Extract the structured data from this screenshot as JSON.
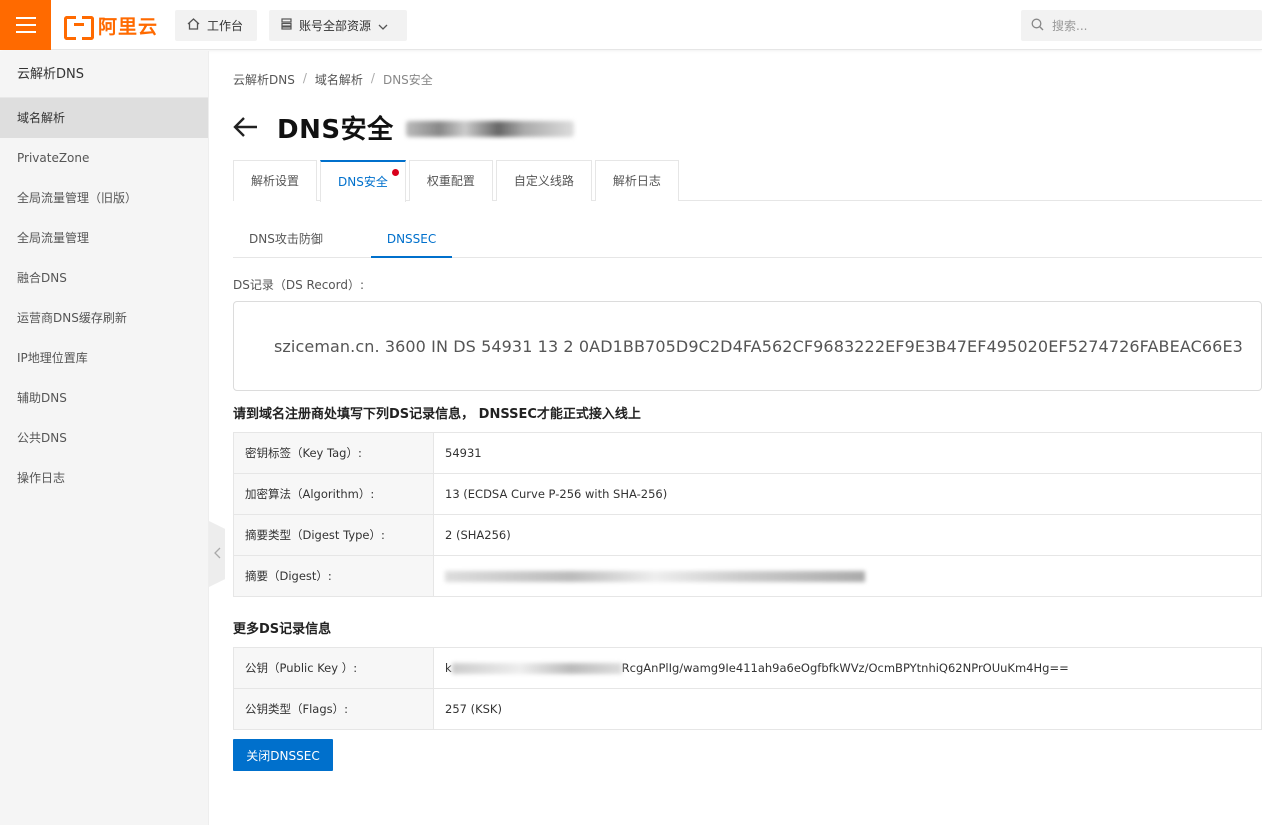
{
  "topbar": {
    "logo_text": "阿里云",
    "workbench_label": "工作台",
    "resources_label": "账号全部资源",
    "search_placeholder": "搜索..."
  },
  "sidebar": {
    "title": "云解析DNS",
    "items": [
      {
        "label": "域名解析",
        "active": true
      },
      {
        "label": "PrivateZone"
      },
      {
        "label": "全局流量管理（旧版）"
      },
      {
        "label": "全局流量管理"
      },
      {
        "label": "融合DNS"
      },
      {
        "label": "运营商DNS缓存刷新"
      },
      {
        "label": "IP地理位置库"
      },
      {
        "label": "辅助DNS"
      },
      {
        "label": "公共DNS"
      },
      {
        "label": "操作日志"
      }
    ]
  },
  "breadcrumb": [
    "云解析DNS",
    "域名解析",
    "DNS安全"
  ],
  "page": {
    "title": "DNS安全"
  },
  "tabs": [
    {
      "label": "解析设置"
    },
    {
      "label": "DNS安全",
      "active": true
    },
    {
      "label": "权重配置"
    },
    {
      "label": "自定义线路"
    },
    {
      "label": "解析日志"
    }
  ],
  "subtabs": [
    {
      "label": "DNS攻击防御"
    },
    {
      "label": "DNSSEC",
      "active": true
    }
  ],
  "ds_record": {
    "label": "DS记录（DS Record）:",
    "value": "sziceman.cn. 3600 IN DS 54931 13 2 0AD1BB705D9C2D4FA562CF9683222EF9E3B47EF495020EF5274726FABEAC66E3"
  },
  "notice": "请到域名注册商处填写下列DS记录信息， DNSSEC才能正式接入线上",
  "ds_info": [
    {
      "key": "密钥标签（Key Tag）:",
      "value": "54931"
    },
    {
      "key": "加密算法（Algorithm）:",
      "value": "13 (ECDSA Curve P-256 with SHA-256)"
    },
    {
      "key": "摘要类型（Digest Type）:",
      "value": "2 (SHA256)"
    },
    {
      "key": "摘要（Digest）:",
      "value": ""
    }
  ],
  "more_title": "更多DS记录信息",
  "more_info": [
    {
      "key": "公钥（Public Key ）:",
      "value_prefix": "k",
      "value": "RcgAnPlIg/wamg9Ie411ah9a6eOgfbfkWVz/OcmBPYtnhiQ62NPrOUuKm4Hg=="
    },
    {
      "key": "公钥类型（Flags）:",
      "value": "257 (KSK)"
    }
  ],
  "actions": {
    "close_dnssec": "关闭DNSSEC"
  },
  "colors": {
    "brand": "#ff6a00",
    "primary": "#0070cc",
    "badge": "#d9001b"
  }
}
